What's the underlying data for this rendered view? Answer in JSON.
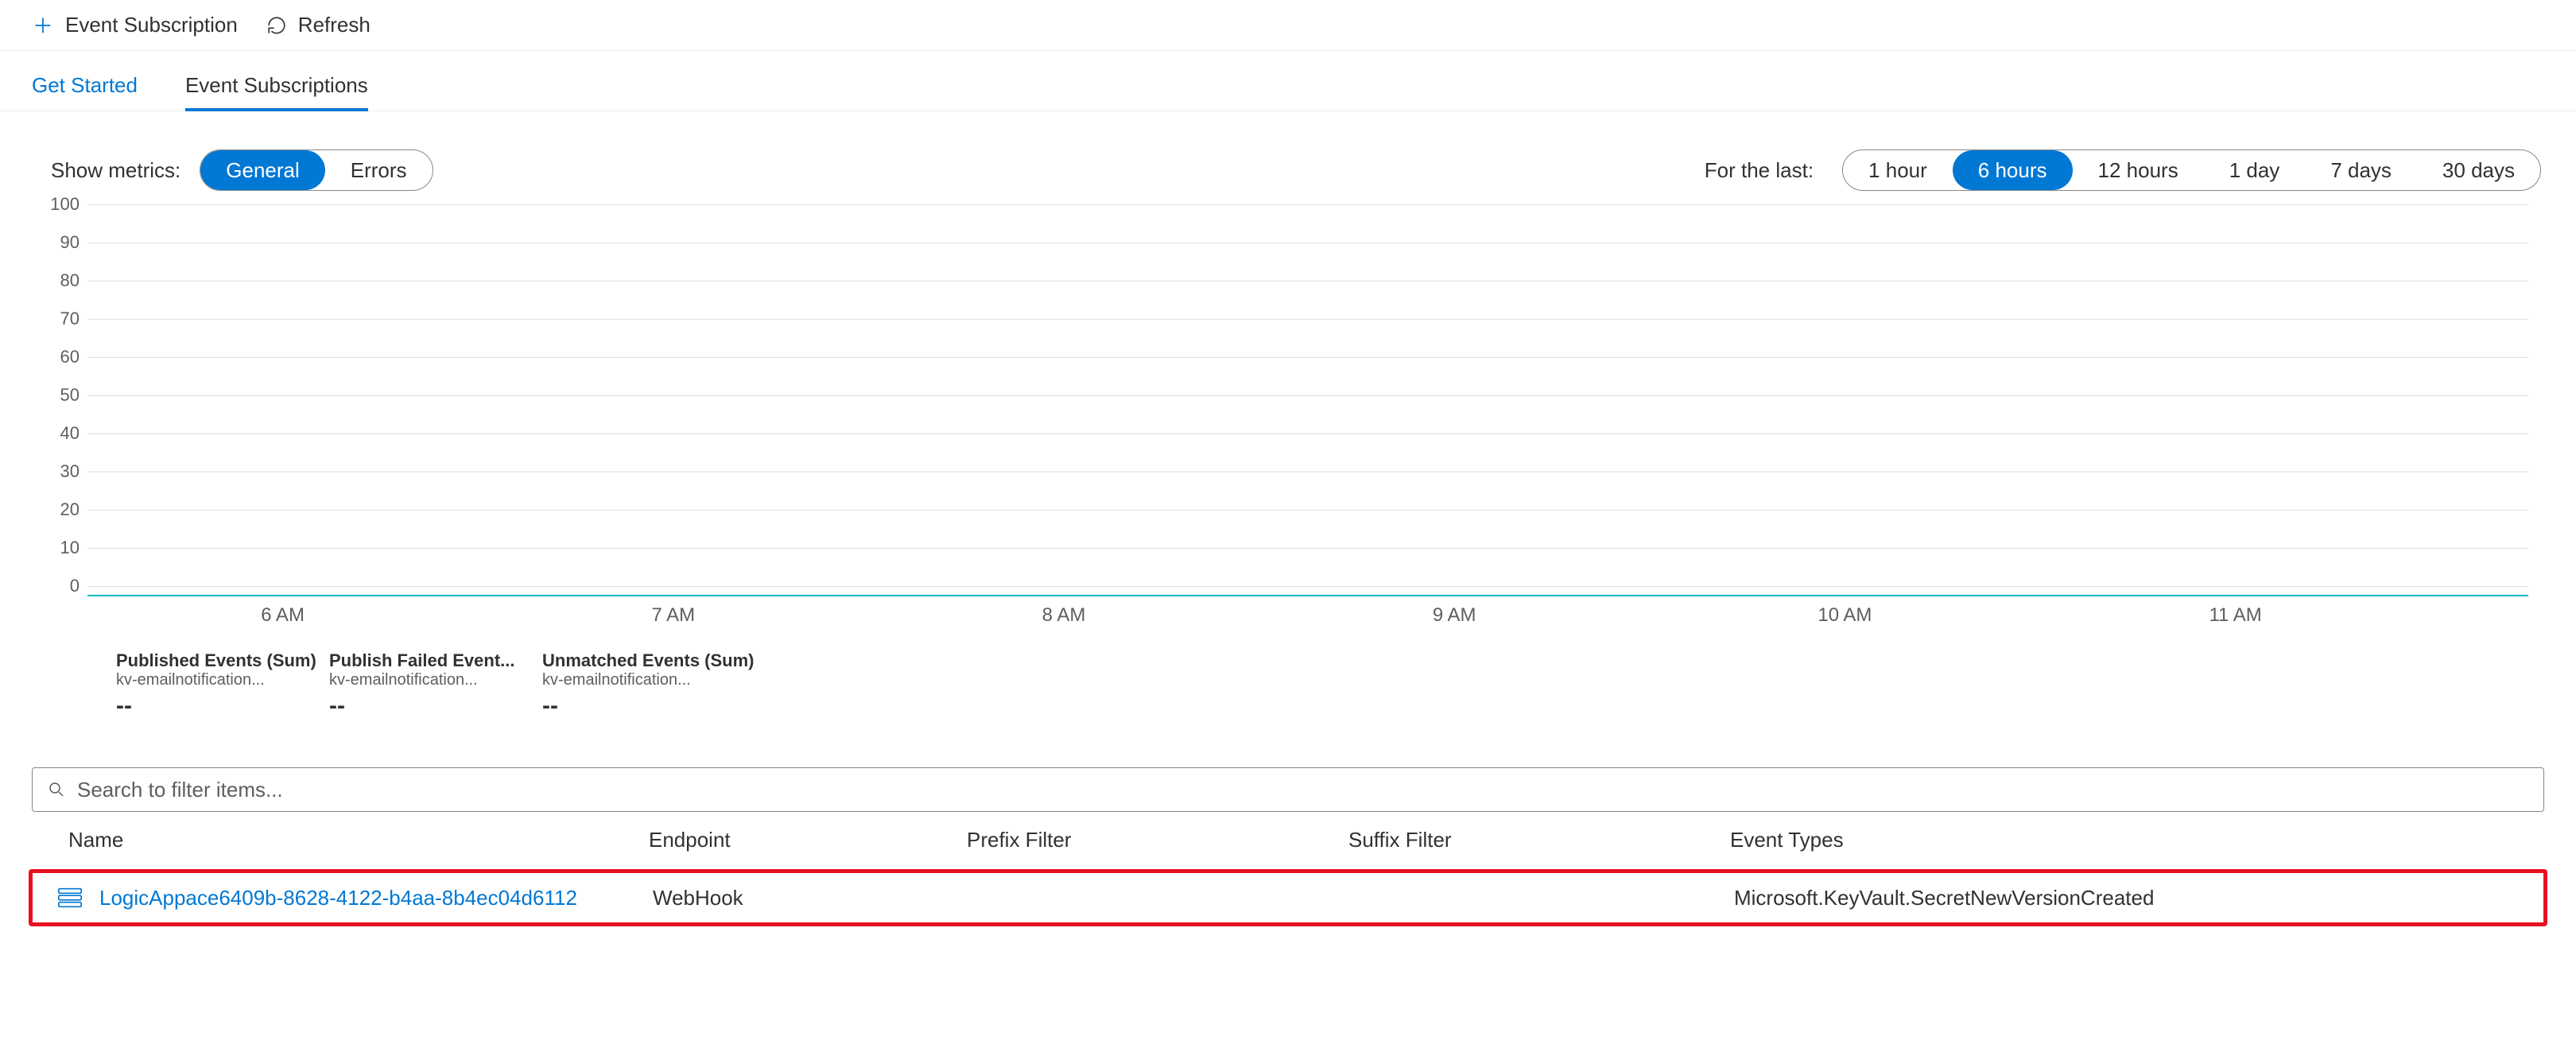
{
  "toolbar": {
    "event_subscription_label": "Event Subscription",
    "refresh_label": "Refresh"
  },
  "tabs": {
    "get_started": "Get Started",
    "event_subscriptions": "Event Subscriptions"
  },
  "metrics": {
    "show_label": "Show metrics:",
    "options": [
      "General",
      "Errors"
    ],
    "selected": "General",
    "for_label": "For the last:",
    "ranges": [
      "1 hour",
      "6 hours",
      "12 hours",
      "1 day",
      "7 days",
      "30 days"
    ],
    "range_selected": "6 hours"
  },
  "chart_data": {
    "type": "line",
    "ylim": [
      0,
      100
    ],
    "y_ticks": [
      100,
      90,
      80,
      70,
      60,
      50,
      40,
      30,
      20,
      10,
      0
    ],
    "x_labels": [
      "6 AM",
      "7 AM",
      "8 AM",
      "9 AM",
      "10 AM",
      "11 AM"
    ],
    "series": [
      {
        "name": "Published Events (Sum)",
        "resource": "kv-emailnotification...",
        "value": "--",
        "color": "#0078d4",
        "values": [
          0,
          0,
          0,
          0,
          0,
          0
        ]
      },
      {
        "name": "Publish Failed Event...",
        "resource": "kv-emailnotification...",
        "value": "--",
        "color": "#002050",
        "values": [
          0,
          0,
          0,
          0,
          0,
          0
        ]
      },
      {
        "name": "Unmatched Events (Sum)",
        "resource": "kv-emailnotification...",
        "value": "--",
        "color": "#00b7c3",
        "values": [
          0,
          0,
          0,
          0,
          0,
          0
        ]
      }
    ]
  },
  "search": {
    "placeholder": "Search to filter items..."
  },
  "table": {
    "headers": {
      "name": "Name",
      "endpoint": "Endpoint",
      "prefix": "Prefix Filter",
      "suffix": "Suffix Filter",
      "types": "Event Types"
    },
    "row": {
      "name": "LogicAppace6409b-8628-4122-b4aa-8b4ec04d6112",
      "endpoint": "WebHook",
      "prefix": "",
      "suffix": "",
      "types": "Microsoft.KeyVault.SecretNewVersionCreated"
    }
  }
}
